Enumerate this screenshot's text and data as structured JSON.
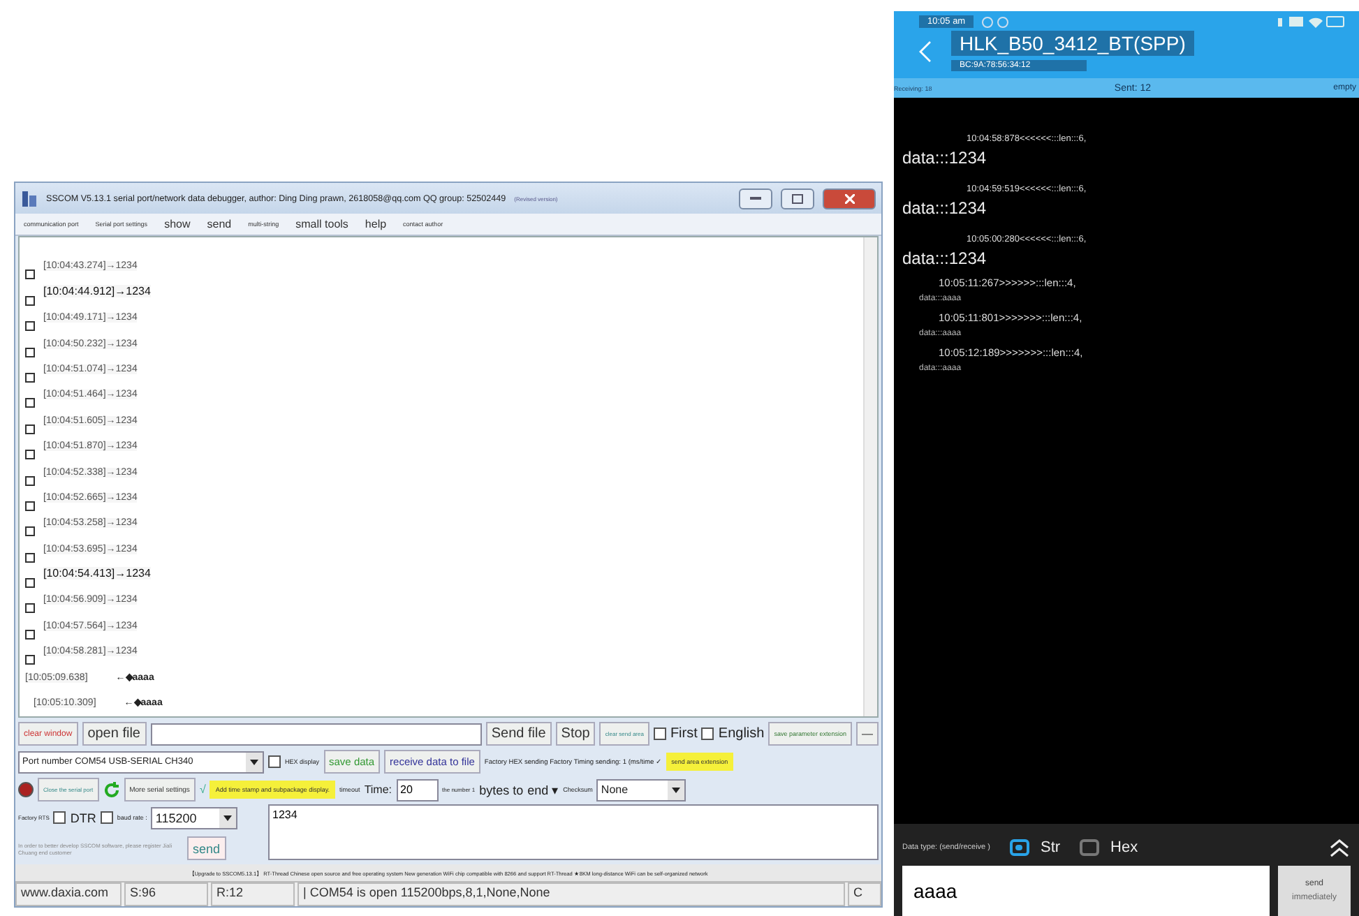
{
  "sscom": {
    "title": "SSCOM V5.13.1 serial port/network data debugger, author: Ding Ding prawn, 2618058@qq.com QQ group: 52502449",
    "title_note": "(Revised version)",
    "menu": [
      "communication port",
      "Serial port settings",
      "show",
      "send",
      "multi-string",
      "small tools",
      "help",
      "contact author"
    ],
    "log": [
      {
        "text": "[10:04:43.274]→1234",
        "bold": false
      },
      {
        "text": "[10:04:44.912]→1234",
        "bold": true
      },
      {
        "text": "[10:04:49.171]→1234",
        "bold": false
      },
      {
        "text": "[10:04:50.232]→1234",
        "bold": false
      },
      {
        "text": "[10:04:51.074]→1234",
        "bold": false
      },
      {
        "text": "[10:04:51.464]→1234",
        "bold": false
      },
      {
        "text": "[10:04:51.605]→1234",
        "bold": false
      },
      {
        "text": "[10:04:51.870]→1234",
        "bold": false
      },
      {
        "text": "[10:04:52.338]→1234",
        "bold": false
      },
      {
        "text": "[10:04:52.665]→1234",
        "bold": false
      },
      {
        "text": "[10:04:53.258]→1234",
        "bold": false
      },
      {
        "text": "[10:04:53.695]→1234",
        "bold": false
      },
      {
        "text": "[10:04:54.413]→1234",
        "bold": true
      },
      {
        "text": "[10:04:56.909]→1234",
        "bold": false
      },
      {
        "text": "[10:04:57.564]→1234",
        "bold": false
      },
      {
        "text": "[10:04:58.281]→1234",
        "bold": false
      }
    ],
    "received": [
      {
        "time": "[10:05:09.638]",
        "data": "←◆aaaa"
      },
      {
        "time": "[10:05:10.309]",
        "data": "←◆aaaa"
      }
    ],
    "clear_window": "clear window",
    "open_file": "open file",
    "send_file": "Send file",
    "stop": "Stop",
    "clear_send": "clear send area",
    "first": {
      "label": "First",
      "checked": false
    },
    "english": {
      "label": "English",
      "checked": false
    },
    "save_params": "save parameter extension",
    "minimize": "—",
    "port": "Port number COM54 USB-SERIAL CH340",
    "hex_display": {
      "label": "HEX display",
      "checked": false
    },
    "save_data": "save data",
    "receive_to_file": "receive data to file",
    "timing": "Factory HEX sending Factory Timing sending: 1 (ms/time ✓",
    "send_area": "send area extension",
    "close_port": "Close the serial port",
    "more_settings": "More serial settings",
    "timestamp": {
      "mark": "√",
      "label": "Add time stamp and subpackage display.",
      "checked": true
    },
    "timeout": "timeout",
    "time_label": "Time:",
    "time_value": "20",
    "number_label": "the number 1",
    "bytes_to": "bytes to",
    "end": "end ▾",
    "checksum_label": "Checksum",
    "checksum": "None",
    "rts": {
      "label": "Factory RTS",
      "checked": false
    },
    "dtr": {
      "label": "DTR",
      "checked": false
    },
    "baud_label": "baud rate :",
    "baud": "115200",
    "send_text": "1234",
    "send": "send",
    "notice": "In order to better develop SSCOM software, please register Jiali Chuang end customer",
    "banner": "【Upgrade to SSCOM5.13.1】 RT-Thread Chinese open source and free operating system New generation WiFi chip compatible with 8266 and support RT-Thread ★8KM long-distance WiFi can be self-organized network",
    "status": [
      "www.daxia.com",
      "S:96",
      "R:12",
      "| COM54 is open 115200bps,8,1,None,None",
      "C"
    ]
  },
  "phone": {
    "time": "10:05 am",
    "title": "HLK_B50_3412_BT(SPP)",
    "address": "BC:9A:78:56:34:12",
    "receiving": "Receiving: 18",
    "sent": "Sent: 12",
    "empty": "empty",
    "messages": [
      {
        "kind": "received",
        "header": "10:04:58:878<<<<<<:::len:::6,",
        "data": "data:::1234"
      },
      {
        "kind": "received",
        "header": "10:04:59:519<<<<<<:::len:::6,",
        "data": "data:::1234"
      },
      {
        "kind": "received",
        "header": "10:05:00:280<<<<<<:::len:::6,",
        "data": "data:::1234"
      },
      {
        "kind": "sent",
        "header": "10:05:11:267>>>>>>:::len:::4,",
        "data": "data:::aaaa"
      },
      {
        "kind": "sent",
        "header": "10:05:11:801>>>>>>>:::len:::4,",
        "data": "data:::aaaa"
      },
      {
        "kind": "sent",
        "header": "10:05:12:189>>>>>>>:::len:::4,",
        "data": "data:::aaaa"
      }
    ],
    "data_type": "Data type: (send/receive )",
    "types": [
      {
        "label": "Str",
        "selected": true
      },
      {
        "label": "Hex",
        "selected": false
      }
    ],
    "input": "aaaa",
    "send": "send",
    "send_sub": "immediately"
  }
}
